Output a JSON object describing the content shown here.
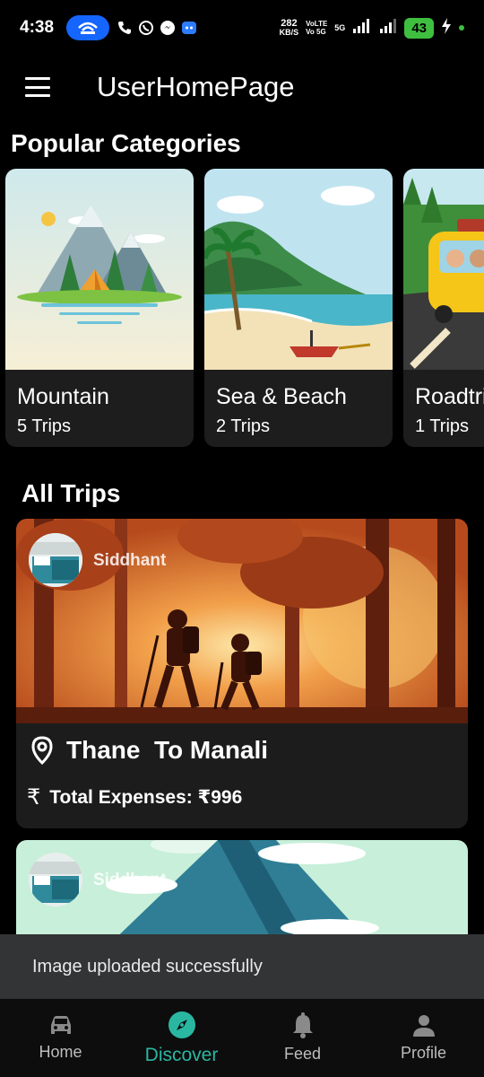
{
  "status_bar": {
    "time": "4:38",
    "net_speed_value": "282",
    "net_speed_unit": "KB/S",
    "volte_top": "VoLTE",
    "volte_bottom": "Vo 5G",
    "signal_label": "5G",
    "battery": "43"
  },
  "app_bar": {
    "title": "UserHomePage"
  },
  "sections": {
    "popular_categories": "Popular Categories",
    "all_trips": "All Trips"
  },
  "categories": [
    {
      "name": "Mountain",
      "count": "5 Trips"
    },
    {
      "name": "Sea & Beach",
      "count": "2 Trips"
    },
    {
      "name": "Roadtrip",
      "count": "1 Trips"
    }
  ],
  "trips": [
    {
      "author": "Siddhant",
      "route": "Thane  To Manali",
      "expense": "Total Expenses: ₹996"
    },
    {
      "author": "Siddhant"
    }
  ],
  "snackbar": {
    "message": "Image uploaded successfully"
  },
  "bottom_nav": [
    {
      "label": "Home",
      "icon": "car-icon"
    },
    {
      "label": "Discover",
      "icon": "compass-icon",
      "active": true
    },
    {
      "label": "Feed",
      "icon": "bell-icon"
    },
    {
      "label": "Profile",
      "icon": "person-icon"
    }
  ],
  "colors": {
    "accent": "#2ab7a2",
    "background": "#000000",
    "card": "#1c1c1c",
    "snackbar": "#333435"
  }
}
